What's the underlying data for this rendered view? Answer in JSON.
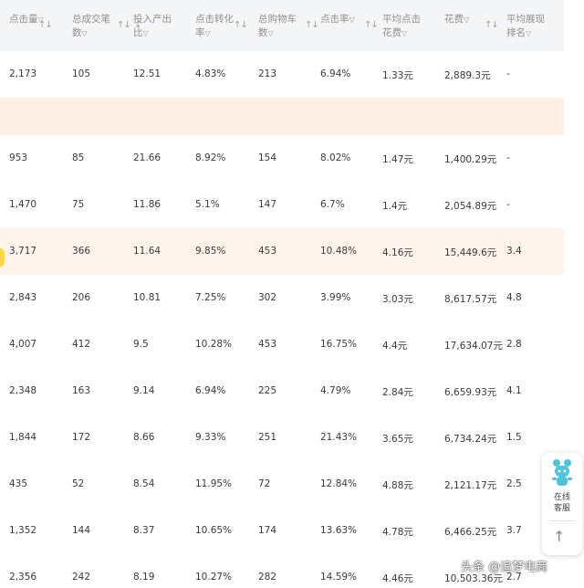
{
  "header": {
    "columns": [
      {
        "line1": "点击量",
        "line2": "",
        "funnel": true,
        "sort": true
      },
      {
        "line1": "总成交笔",
        "line2": "数",
        "funnel": true,
        "sort": true
      },
      {
        "line1": "投入产出",
        "line2": "比",
        "funnel": true,
        "sort": true,
        "sort_desc": true
      },
      {
        "line1": "点击转化",
        "line2": "率",
        "funnel": true,
        "sort": true
      },
      {
        "line1": "总购物车",
        "line2": "数",
        "funnel": true,
        "sort": true
      },
      {
        "line1": "点击率",
        "line2": "",
        "funnel": true,
        "sort": true
      },
      {
        "line1": "平均点击",
        "line2": "花费",
        "funnel": true,
        "sort": false
      },
      {
        "line1": "花费",
        "line2": "",
        "funnel": true,
        "sort": true
      },
      {
        "line1": "平均展现",
        "line2": "排名",
        "funnel": true,
        "sort": false
      }
    ]
  },
  "rows": [
    {
      "highlight": false,
      "blank": false,
      "cells": [
        "2,173",
        "105",
        "12.51",
        "4.83%",
        "213",
        "6.94%",
        "1.33元",
        "2,889.3元",
        "-"
      ]
    },
    {
      "highlight": false,
      "blank": true,
      "cells": [
        "",
        "",
        "",
        "",
        "",
        "",
        "",
        "",
        ""
      ]
    },
    {
      "highlight": false,
      "blank": false,
      "cells": [
        "953",
        "85",
        "21.66",
        "8.92%",
        "154",
        "8.02%",
        "1.47元",
        "1,400.29元",
        "-"
      ]
    },
    {
      "highlight": false,
      "blank": false,
      "cells": [
        "1,470",
        "75",
        "11.86",
        "5.1%",
        "147",
        "6.7%",
        "1.4元",
        "2,054.89元",
        "-"
      ]
    },
    {
      "highlight": true,
      "blank": false,
      "cells": [
        "3,717",
        "366",
        "11.64",
        "9.85%",
        "453",
        "10.48%",
        "4.16元",
        "15,449.6元",
        "3.4"
      ]
    },
    {
      "highlight": false,
      "blank": false,
      "cells": [
        "2,843",
        "206",
        "10.81",
        "7.25%",
        "302",
        "3.99%",
        "3.03元",
        "8,617.57元",
        "4.8"
      ]
    },
    {
      "highlight": false,
      "blank": false,
      "cells": [
        "4,007",
        "412",
        "9.5",
        "10.28%",
        "453",
        "16.75%",
        "4.4元",
        "17,634.07元",
        "2.8"
      ]
    },
    {
      "highlight": false,
      "blank": false,
      "cells": [
        "2,348",
        "163",
        "9.14",
        "6.94%",
        "225",
        "4.79%",
        "2.84元",
        "6,659.93元",
        "4.1"
      ]
    },
    {
      "highlight": false,
      "blank": false,
      "cells": [
        "1,844",
        "172",
        "8.66",
        "9.33%",
        "251",
        "21.43%",
        "3.65元",
        "6,734.24元",
        "1.5"
      ]
    },
    {
      "highlight": false,
      "blank": false,
      "cells": [
        "435",
        "52",
        "8.54",
        "11.95%",
        "72",
        "12.84%",
        "4.88元",
        "2,121.17元",
        "2.5"
      ]
    },
    {
      "highlight": false,
      "blank": false,
      "cells": [
        "1,352",
        "144",
        "8.37",
        "10.65%",
        "174",
        "13.63%",
        "4.78元",
        "6,466.25元",
        "3.7"
      ]
    },
    {
      "highlight": false,
      "blank": false,
      "cells": [
        "2,356",
        "242",
        "8.19",
        "10.27%",
        "282",
        "14.59%",
        "4.46元",
        "10,503.36元",
        "2.7"
      ]
    }
  ],
  "widget": {
    "line1": "在线",
    "line2": "客服",
    "top_arrow": "↑"
  },
  "watermark": "头条 @追梦电商",
  "colors": {
    "header_bg": "#f4f5f7",
    "highlight_row": "#fff4ec",
    "blank_row": "#fff0e6",
    "marker": "#ffd84a",
    "robot": "#4fc3d9"
  }
}
